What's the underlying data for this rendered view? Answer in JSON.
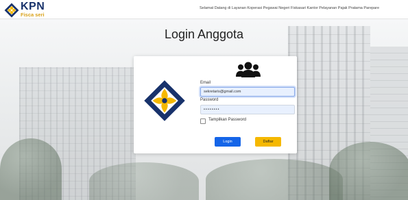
{
  "navbar": {
    "brand_name": "KPN",
    "brand_sub": "Fisca seri",
    "welcome_text": "Selamat Datang di Layanan Koperasi Pegawai Negeri Fiskasari Kantor Pelayanan Pajak Pratama Parepare"
  },
  "page": {
    "title": "Login Anggota"
  },
  "form": {
    "email_label": "Email",
    "email_value": "sekretaris@gmail.com",
    "password_label": "Password",
    "password_value": "••••••••",
    "show_password_label": "Tampilkan Password",
    "show_password_checked": false,
    "login_button": "Login",
    "register_button": "Daftar"
  },
  "icons": {
    "logo": "kpn-diamond-logo",
    "users": "users-group-icon"
  },
  "colors": {
    "brand_navy": "#18326b",
    "brand_gold": "#f5b800",
    "login_blue": "#1565e8",
    "daftar_yellow": "#f5b800"
  }
}
